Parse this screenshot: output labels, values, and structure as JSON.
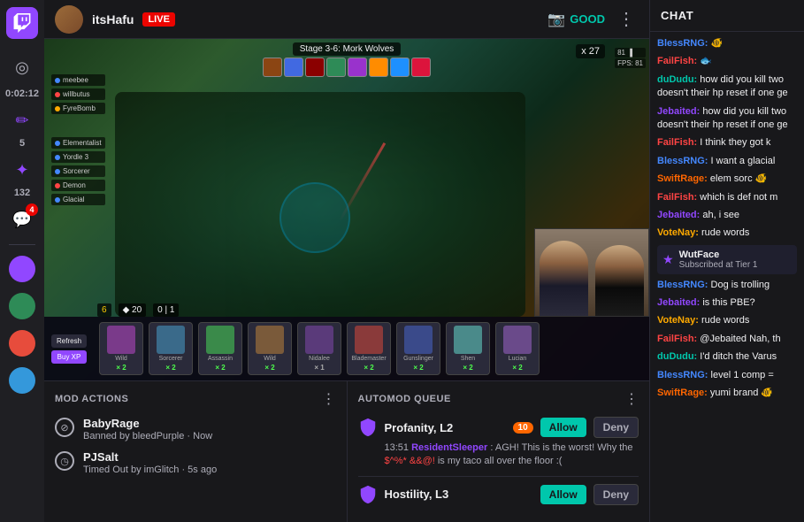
{
  "sidebar": {
    "logo_label": "Twitch",
    "icons": [
      {
        "name": "headset-icon",
        "symbol": "◎",
        "active": false,
        "badge": null
      },
      {
        "name": "pen-icon",
        "symbol": "✏",
        "active": false,
        "badge": null,
        "number": "5"
      },
      {
        "name": "star-icon",
        "symbol": "✦",
        "active": false,
        "badge": null,
        "number": "132"
      },
      {
        "name": "chat-icon",
        "symbol": "💬",
        "active": false,
        "badge": "4"
      }
    ],
    "avatars": [
      {
        "name": "avatar-1",
        "color": "#9147ff"
      },
      {
        "name": "avatar-2",
        "color": "#2e8b57"
      },
      {
        "name": "avatar-3",
        "color": "#e74c3c"
      },
      {
        "name": "avatar-4",
        "color": "#3498db"
      }
    ]
  },
  "header": {
    "streamer_name": "itsHafu",
    "live_label": "LIVE",
    "quality_label": "GOOD",
    "timer": "0:02:12"
  },
  "chat": {
    "title": "CHAT",
    "messages": [
      {
        "user": "BlessRNG:",
        "user_color": "#4488ff",
        "text": " 🐠",
        "emote": true
      },
      {
        "user": "FailFish:",
        "user_color": "#ff4444",
        "text": " 🐟",
        "emote": true
      },
      {
        "user": "duDudu:",
        "user_color": "#00c7ac",
        "text": " how did you kill two doesn't their hp reset if one ge"
      },
      {
        "user": "Jebaited:",
        "user_color": "#9147ff",
        "text": " how did you kill two doesn't their hp reset if one ge"
      },
      {
        "user": "FailFish:",
        "user_color": "#ff4444",
        "text": " I think they got k"
      },
      {
        "user": "BlessRNG:",
        "user_color": "#4488ff",
        "text": " I want a glacial"
      },
      {
        "user": "SwiftRage:",
        "user_color": "#ff6600",
        "text": " elem sorc 🐠"
      },
      {
        "user": "FailFish:",
        "user_color": "#ff4444",
        "text": " which is def not m"
      },
      {
        "user": "Jebaited:",
        "user_color": "#9147ff",
        "text": " ah, i see"
      },
      {
        "user": "VoteNay:",
        "user_color": "#ffaa00",
        "text": " rude words"
      },
      {
        "sub": true,
        "sub_name": "WutFace",
        "sub_tier": "Subscribed at Tier 1"
      },
      {
        "user": "BlessRNG:",
        "user_color": "#4488ff",
        "text": " Dog is trolling"
      },
      {
        "user": "Jebaited:",
        "user_color": "#9147ff",
        "text": " is this PBE?"
      },
      {
        "user": "VoteNay:",
        "user_color": "#ffaa00",
        "text": " rude words"
      },
      {
        "user": "FailFish:",
        "user_color": "#ff4444",
        "text": " @Jebaited Nah, th"
      },
      {
        "user": "duDudu:",
        "user_color": "#00c7ac",
        "text": " I'd ditch the Varus"
      },
      {
        "user": "BlessRNG:",
        "user_color": "#4488ff",
        "text": " level 1 comp ="
      },
      {
        "user": "SwiftRage:",
        "user_color": "#ff6600",
        "text": " yumi brand 🐠"
      }
    ]
  },
  "mod_actions": {
    "title": "MOD ACTIONS",
    "items": [
      {
        "name": "BabyRage",
        "sub": "Banned by bleedPurple · Now"
      },
      {
        "name": "PJSalt",
        "sub": "Timed Out by imGlitch · 5s ago"
      }
    ]
  },
  "automod_queue": {
    "title": "AUTOMOD QUEUE",
    "items": [
      {
        "type": "Profanity, L2",
        "level": "10",
        "level_class": "l2",
        "timestamp": "13:51",
        "user": "ResidentSleeper",
        "message_parts": [
          {
            "text": "AGH! This is the worst! Why the ",
            "highlight": false
          },
          {
            "text": "$^%* &&@!",
            "highlight": true
          },
          {
            "text": " is my taco all over the floor :(",
            "highlight": false
          }
        ],
        "allow_label": "Allow",
        "deny_label": "Deny"
      },
      {
        "type": "Hostility, L3",
        "level": "L3",
        "level_class": "l3",
        "allow_label": "Allow",
        "deny_label": "Deny"
      }
    ]
  }
}
